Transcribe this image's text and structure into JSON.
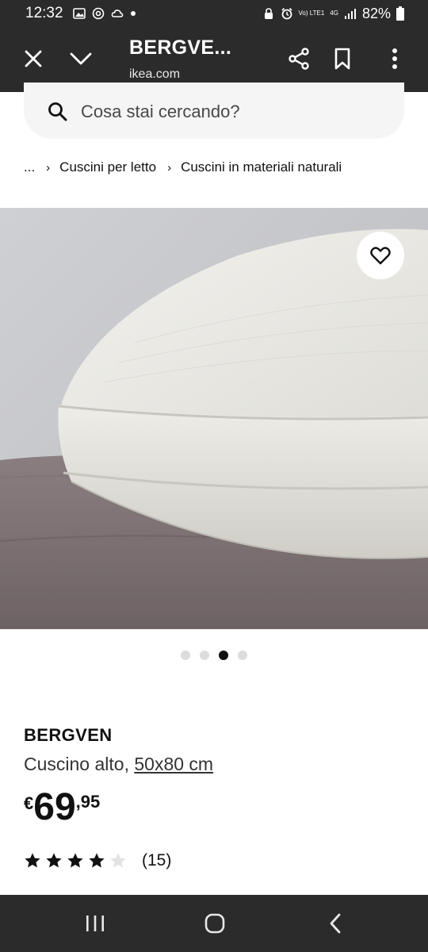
{
  "status": {
    "time": "12:32",
    "battery": "82%",
    "volte": "Vo) LTE1",
    "network": "4G"
  },
  "browser": {
    "title": "BERGVE...",
    "url": "ikea.com"
  },
  "search": {
    "placeholder": "Cosa stai cercando?"
  },
  "breadcrumb": {
    "ellipsis": "...",
    "items": [
      "Cuscini per letto",
      "Cuscini in materiali naturali"
    ]
  },
  "carousel": {
    "total": 4,
    "active_index": 2
  },
  "product": {
    "name": "BERGVEN",
    "description": "Cuscino alto,",
    "size": "50x80 cm",
    "price": {
      "currency": "€",
      "integer": "69",
      "decimal": ",95"
    },
    "rating": {
      "stars": 4,
      "max": 5,
      "count": "(15)"
    }
  },
  "icons": {
    "close": "close-icon",
    "collapse": "chevron-down-icon",
    "share": "share-icon",
    "bookmark": "bookmark-icon",
    "more": "more-vert-icon",
    "search": "search-icon",
    "favorite": "heart-icon"
  },
  "colors": {
    "bars": "#2b2b2b",
    "search_bg": "#f5f5f5",
    "text": "#111111"
  }
}
